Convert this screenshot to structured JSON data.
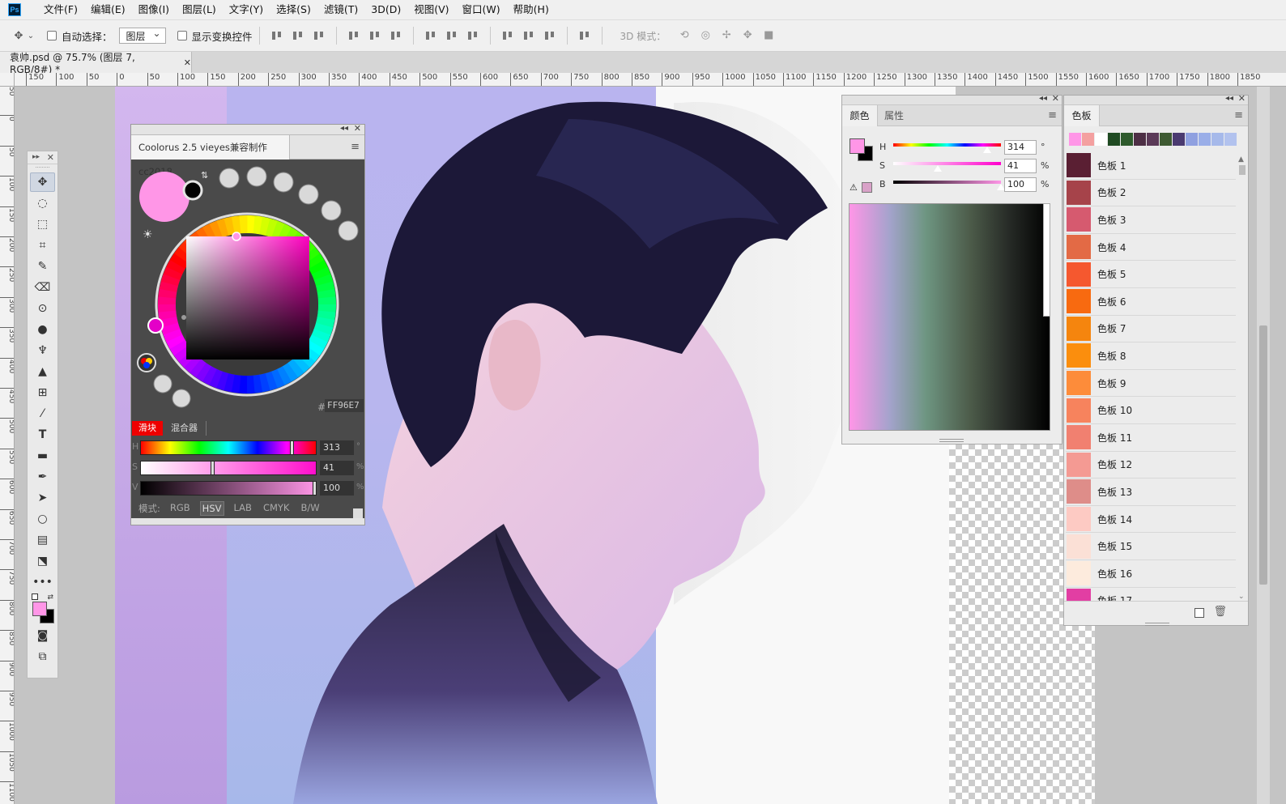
{
  "app": {
    "logo": "Ps"
  },
  "menubar": {
    "items": [
      "文件(F)",
      "编辑(E)",
      "图像(I)",
      "图层(L)",
      "文字(Y)",
      "选择(S)",
      "滤镜(T)",
      "3D(D)",
      "视图(V)",
      "窗口(W)",
      "帮助(H)"
    ]
  },
  "options": {
    "auto_select_label": "自动选择：",
    "auto_select_value": "图层",
    "show_transform_label": "显示变换控件",
    "mode_3d_label": "3D 模式："
  },
  "document": {
    "tab_title": "袁帅.psd @ 75.7% (图层 7, RGB/8#) *"
  },
  "rulers": {
    "h_labels": [
      "150",
      "100",
      "50",
      "0",
      "50",
      "100",
      "150",
      "200",
      "250",
      "300",
      "350",
      "400",
      "450",
      "500",
      "550",
      "600",
      "650",
      "700",
      "750",
      "800",
      "850",
      "900",
      "950",
      "1000",
      "1050",
      "1100",
      "1150",
      "1200",
      "1250",
      "1300",
      "1350",
      "1400",
      "1450",
      "1500",
      "1550",
      "1600",
      "1650",
      "1700",
      "1750",
      "1800",
      "1850"
    ],
    "v_labels": [
      "50",
      "0",
      "50",
      "100",
      "150",
      "200",
      "250",
      "300",
      "350",
      "400",
      "450",
      "500",
      "550",
      "600",
      "650",
      "700",
      "750",
      "800",
      "850",
      "900",
      "950",
      "1000",
      "1050",
      "1100"
    ]
  },
  "coolorus": {
    "title": "Coolorus 2.5 vieyes兼容制作cc2018",
    "hex": "FF96E7",
    "tab_slider": "滑块",
    "tab_mixer": "混合器",
    "sliders": [
      {
        "label": "H",
        "value": "313",
        "unit": "°",
        "level": 313,
        "max": 360
      },
      {
        "label": "S",
        "value": "41",
        "unit": "%",
        "level": 41,
        "max": 100
      },
      {
        "label": "V",
        "value": "100",
        "unit": "%",
        "level": 100,
        "max": 100
      }
    ],
    "mode_label": "模式:",
    "modes": [
      "RGB",
      "HSV",
      "LAB",
      "CMYK",
      "B/W"
    ],
    "selected_mode": "HSV"
  },
  "color_panel": {
    "tab_color": "颜色",
    "tab_properties": "属性",
    "rows": [
      {
        "label": "H",
        "value": "314",
        "unit": "°",
        "level": 314,
        "max": 360
      },
      {
        "label": "S",
        "value": "41",
        "unit": "%",
        "level": 41,
        "max": 100
      },
      {
        "label": "B",
        "value": "100",
        "unit": "%",
        "level": 100,
        "max": 100
      }
    ]
  },
  "swatches": {
    "tab_label": "色板",
    "recent_colors": [
      "#ff96e7",
      "#f4a0a0",
      "#ffffff",
      "#1f4a22",
      "#2e5a2c",
      "#4d2f45",
      "#5b3a58",
      "#3e5a32",
      "#4a3a70",
      "#8fa0e0",
      "#9aaee8",
      "#a6b9ea",
      "#b2c2ee"
    ],
    "items": [
      {
        "name": "色板 1",
        "color": "#5a1f33"
      },
      {
        "name": "色板 2",
        "color": "#a6434a"
      },
      {
        "name": "色板 3",
        "color": "#d65a6f"
      },
      {
        "name": "色板 4",
        "color": "#e36a45"
      },
      {
        "name": "色板 5",
        "color": "#f5582f"
      },
      {
        "name": "色板 6",
        "color": "#f86a10"
      },
      {
        "name": "色板 7",
        "color": "#f5850e"
      },
      {
        "name": "色板 8",
        "color": "#fb8e0d"
      },
      {
        "name": "色板 9",
        "color": "#fd8c3a"
      },
      {
        "name": "色板 10",
        "color": "#f7835d"
      },
      {
        "name": "色板 11",
        "color": "#f18070"
      },
      {
        "name": "色板 12",
        "color": "#f49a93"
      },
      {
        "name": "色板 13",
        "color": "#de8d89"
      },
      {
        "name": "色板 14",
        "color": "#fdcac3"
      },
      {
        "name": "色板 15",
        "color": "#fbe0d6"
      },
      {
        "name": "色板 16",
        "color": "#fdebdd"
      },
      {
        "name": "色板 17",
        "color": "#e23ea3"
      }
    ]
  },
  "colors": {
    "foreground": "#ff96e7",
    "background": "#000000",
    "accent_red": "#ee0000"
  }
}
